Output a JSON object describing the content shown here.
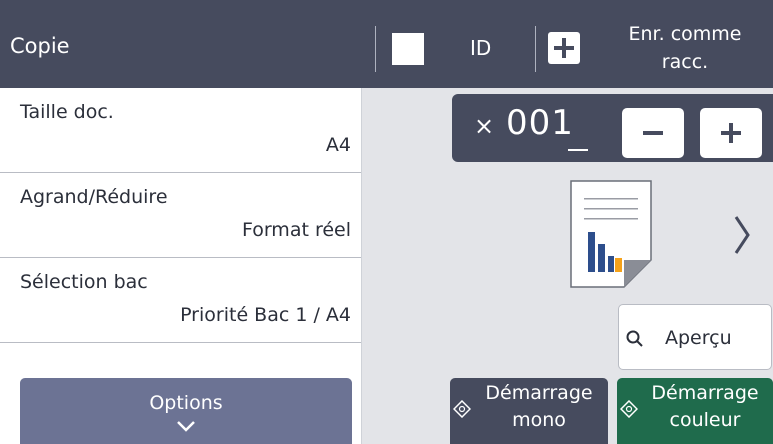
{
  "header": {
    "title": "Copie",
    "id_label": "ID",
    "shortcut_line1": "Enr. comme",
    "shortcut_line2": "racc."
  },
  "settings": [
    {
      "label": "Taille doc.",
      "value": "A4"
    },
    {
      "label": "Agrand/Réduire",
      "value": "Format réel"
    },
    {
      "label": "Sélection bac",
      "value": "Priorité Bac 1 / A4"
    }
  ],
  "options": {
    "label": "Options",
    "icon": "chevron-down-icon"
  },
  "copies": {
    "prefix": "×",
    "count": "001"
  },
  "preview": {
    "label": "Aperçu",
    "icon": "search-icon"
  },
  "start": {
    "mono_line1": "Démarrage",
    "mono_line2": "mono",
    "color_line1": "Démarrage",
    "color_line2": "couleur",
    "icon": "start-diamond-icon"
  },
  "colors": {
    "header_bg": "#464b5e",
    "options_bg": "#6c7394",
    "start_color_bg": "#1f6b4c",
    "panel_bg": "#e3e4e8",
    "doc_bar_blue": "#2d4e8c",
    "doc_bar_orange": "#f5a21a"
  }
}
